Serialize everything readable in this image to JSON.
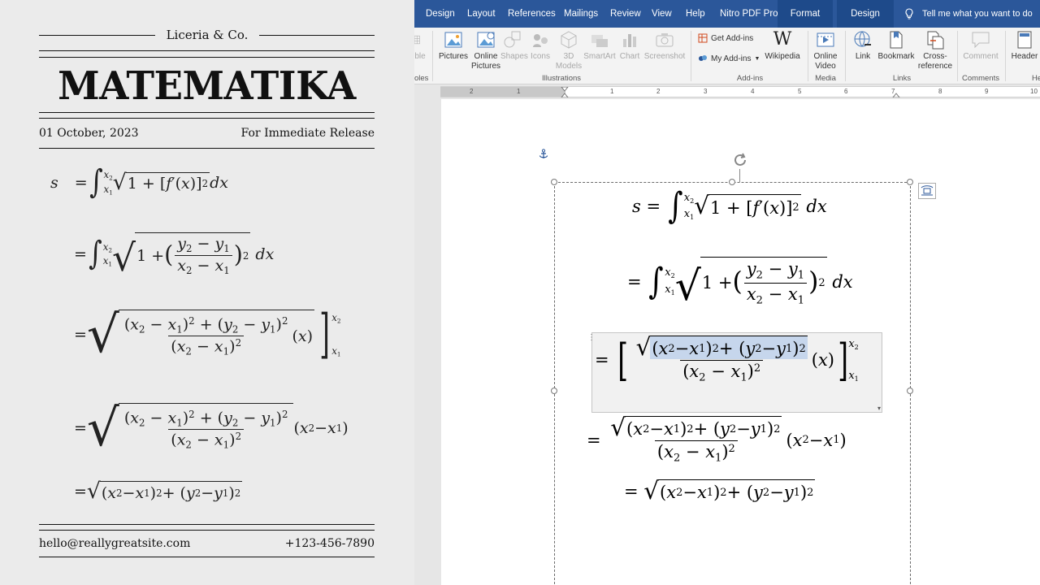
{
  "slide": {
    "publisher": "Liceria & Co.",
    "title": "MATEMATIKA",
    "date": "01 October, 2023",
    "release": "For Immediate Release",
    "email": "hello@reallygreatsite.com",
    "phone": "+123-456-7890"
  },
  "word": {
    "tabs": [
      "Design",
      "Layout",
      "References",
      "Mailings",
      "Review",
      "View",
      "Help",
      "Nitro PDF Pro",
      "Format",
      "Design"
    ],
    "tell_me": "Tell me what you want to do",
    "ribbon": {
      "tables_partial": "ble",
      "tables_group_partial": "oles",
      "pictures": "Pictures",
      "online_pictures_1": "Online",
      "online_pictures_2": "Pictures",
      "shapes": "Shapes",
      "icons": "Icons",
      "models_1": "3D",
      "models_2": "Models",
      "smartart": "SmartArt",
      "chart": "Chart",
      "screenshot": "Screenshot",
      "illustrations_group": "Illustrations",
      "get_addins": "Get Add-ins",
      "my_addins": "My Add-ins",
      "wikipedia": "Wikipedia",
      "addins_group": "Add-ins",
      "online_video_1": "Online",
      "online_video_2": "Video",
      "media_group": "Media",
      "link": "Link",
      "bookmark": "Bookmark",
      "crossref_1": "Cross-",
      "crossref_2": "reference",
      "links_group": "Links",
      "comment": "Comment",
      "comments_group": "Comments",
      "header": "Header",
      "header_group_partial": "Hea"
    },
    "ruler_numbers": [
      "2",
      "1",
      "1",
      "2",
      "3",
      "4",
      "5",
      "6",
      "7",
      "8",
      "9",
      "10"
    ]
  },
  "colors": {
    "word_blue": "#2b579a",
    "slide_bg": "#ebebeb",
    "selection": "#c6d6ec"
  },
  "icons": [
    "anchor-icon",
    "rotate-icon",
    "layout-options-icon",
    "lightbulb-icon"
  ]
}
